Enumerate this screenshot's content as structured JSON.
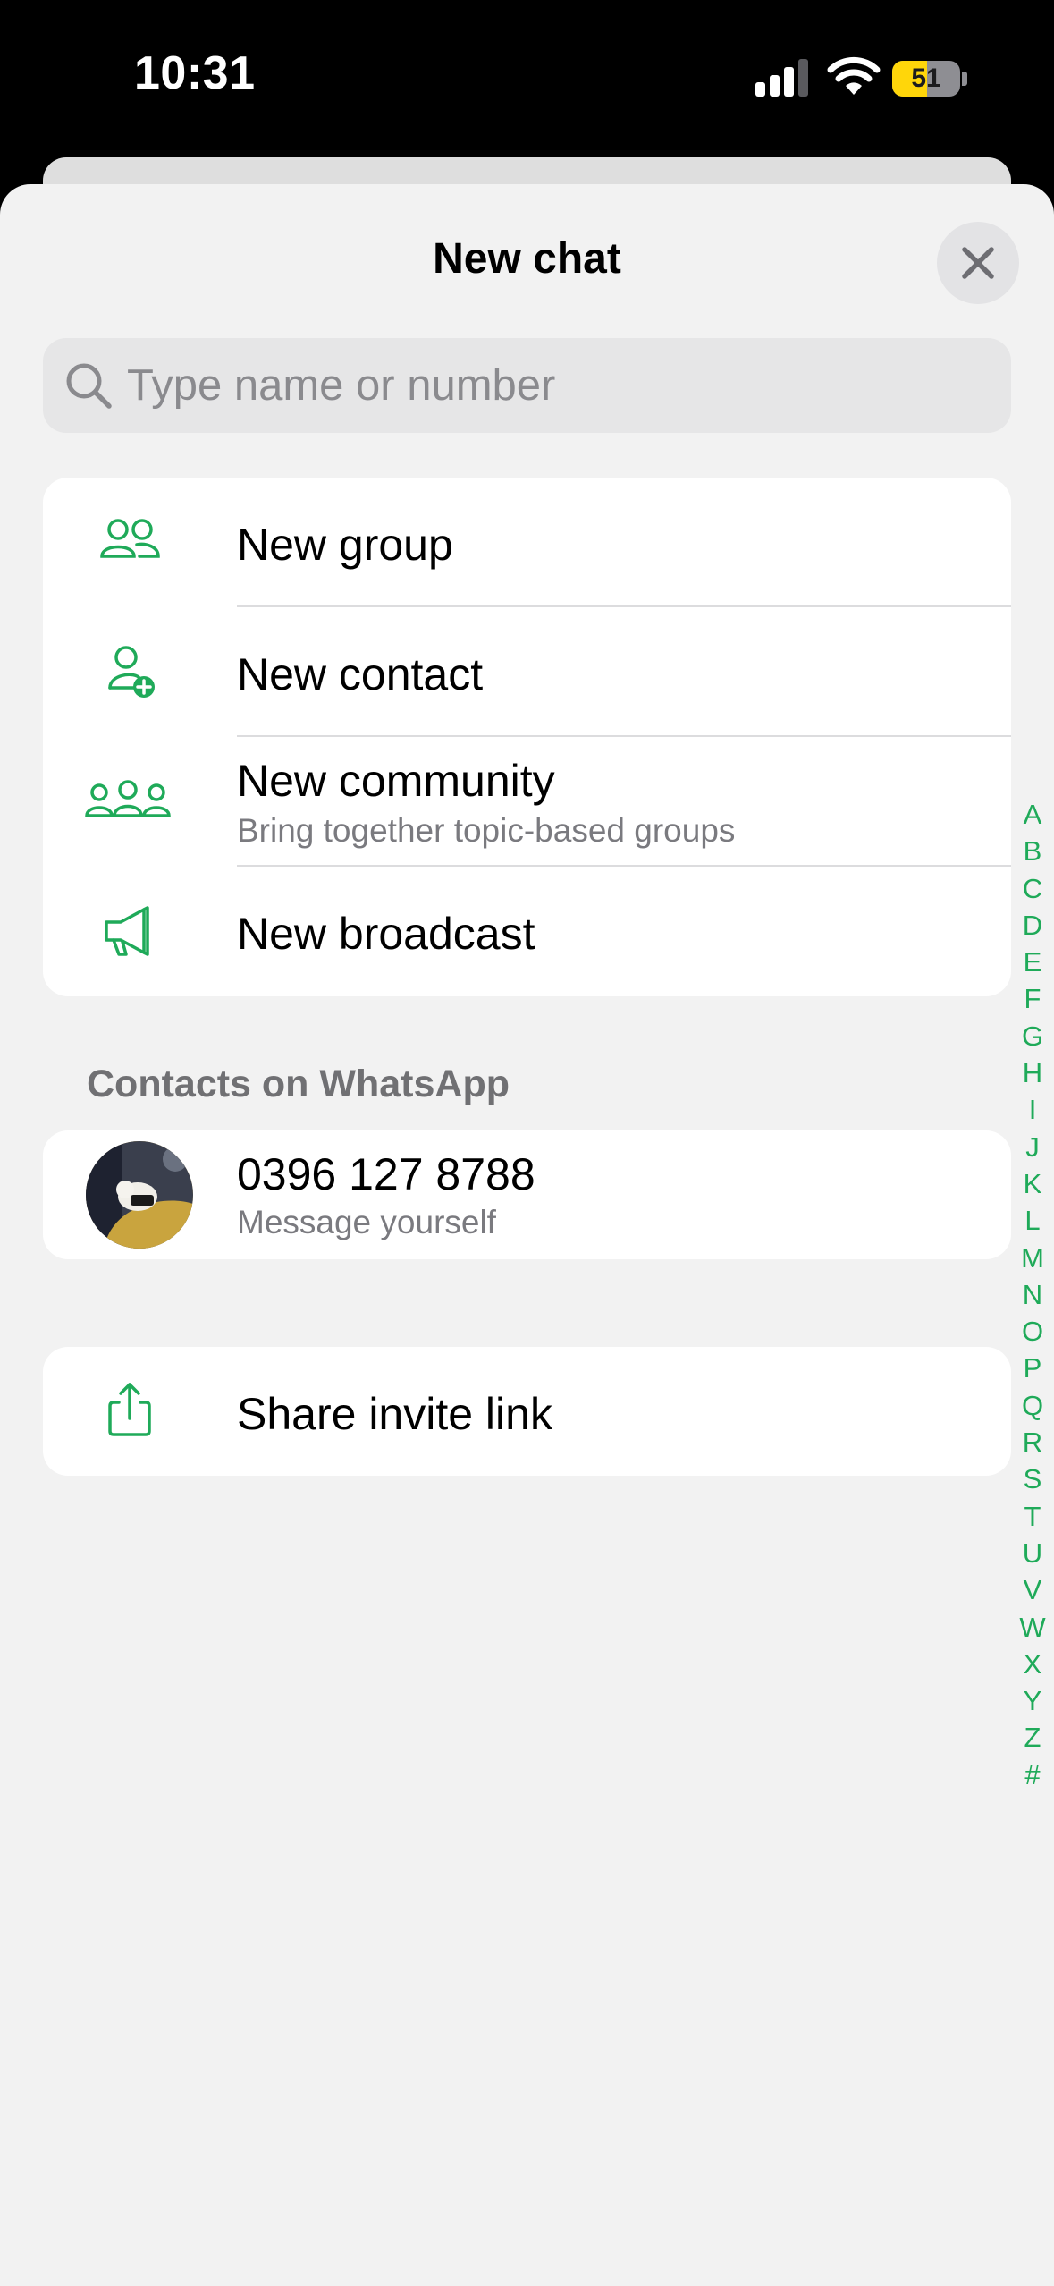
{
  "status_bar": {
    "time": "10:31",
    "battery": "51",
    "battery_level": 0.51
  },
  "sheet": {
    "title": "New chat"
  },
  "search": {
    "placeholder": "Type name or number",
    "value": ""
  },
  "actions": [
    {
      "label": "New group",
      "icon": "group-icon"
    },
    {
      "label": "New contact",
      "icon": "add-contact-icon"
    },
    {
      "label": "New community",
      "subtitle": "Bring together topic-based groups",
      "icon": "community-icon"
    },
    {
      "label": "New broadcast",
      "icon": "megaphone-icon"
    }
  ],
  "contacts_section": {
    "header": "Contacts on WhatsApp",
    "items": [
      {
        "name": "0396 127 8788",
        "subtitle": "Message yourself"
      }
    ]
  },
  "share": {
    "label": "Share invite link",
    "icon": "share-icon"
  },
  "index_letters": [
    "A",
    "B",
    "C",
    "D",
    "E",
    "F",
    "G",
    "H",
    "I",
    "J",
    "K",
    "L",
    "M",
    "N",
    "O",
    "P",
    "Q",
    "R",
    "S",
    "T",
    "U",
    "V",
    "W",
    "X",
    "Y",
    "Z",
    "#"
  ],
  "colors": {
    "accent": "#1faa59",
    "sheet_bg": "#f2f2f2",
    "card_bg": "#ffffff"
  }
}
